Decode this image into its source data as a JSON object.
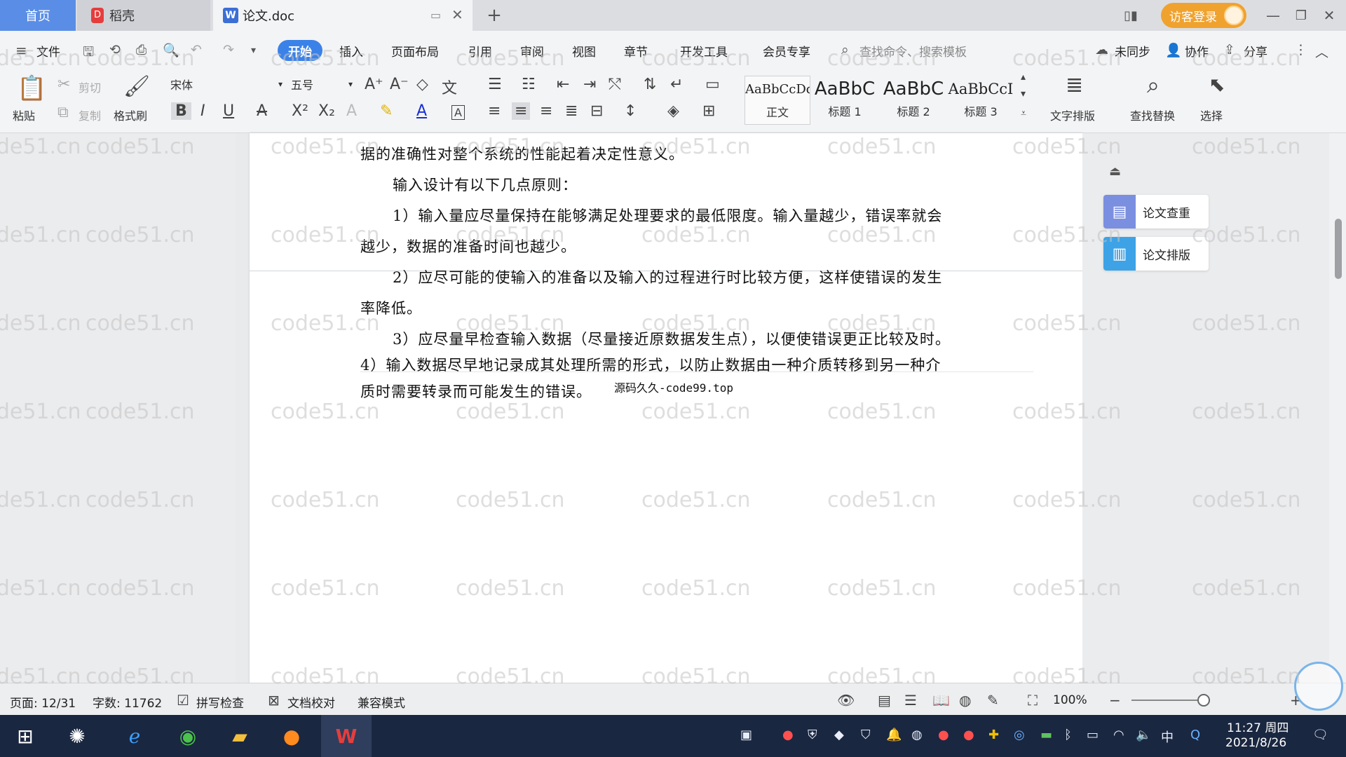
{
  "titlebar": {
    "tab_home": "首页",
    "tab_daoke": "稻壳",
    "tab_doc": "论文.doc",
    "login_button": "访客登录"
  },
  "menubar": {
    "file": "文件",
    "items": [
      "开始",
      "插入",
      "页面布局",
      "引用",
      "审阅",
      "视图",
      "章节",
      "开发工具",
      "会员专享"
    ],
    "search_placeholder": "查找命令、搜索模板",
    "sync": "未同步",
    "collab": "协作",
    "share": "分享"
  },
  "ribbon": {
    "paste": "粘贴",
    "cut": "剪切",
    "copy": "复制",
    "format_painter": "格式刷",
    "font_name": "宋体",
    "font_size": "五号",
    "styles": [
      {
        "sample": "AaBbCcDd",
        "label": "正文"
      },
      {
        "sample": "AaBbC",
        "label": "标题 1"
      },
      {
        "sample": "AaBbC",
        "label": "标题 2"
      },
      {
        "sample": "AaBbCcI",
        "label": "标题 3"
      }
    ],
    "text_layout": "文字排版",
    "find_replace": "查找替换",
    "select": "选择"
  },
  "document": {
    "paragraphs": [
      "据的准确性对整个系统的性能起着决定性意义。",
      "输入设计有以下几点原则：",
      "1）输入量应尽量保持在能够满足处理要求的最低限度。输入量越少，错误率就会",
      "越少，数据的准备时间也越少。",
      "2）应尽可能的使输入的准备以及输入的过程进行时比较方便，这样使错误的发生",
      "率降低。",
      "3）应尽量早检查输入数据（尽量接近原数据发生点），以便使错误更正比较及时。",
      "4）输入数据尽早地记录成其处理所需的形式，以防止数据由一种介质转移到另一种介",
      "质时需要转录而可能发生的错误。"
    ],
    "source_note": "源码久久-code99.top"
  },
  "side_panel": {
    "check": "论文查重",
    "layout": "论文排版"
  },
  "statusbar": {
    "page": "页面: 12/31",
    "words": "字数: 11762",
    "spell": "拼写检查",
    "proof": "文档校对",
    "compat": "兼容模式",
    "zoom": "100%"
  },
  "taskbar": {
    "time": "11:27 周四",
    "date": "2021/8/26",
    "ime": "中"
  },
  "watermark": "code51.cn",
  "colors": {
    "accent": "#3b82e8",
    "login": "#f0a22e",
    "taskbar": "#1a2740"
  }
}
